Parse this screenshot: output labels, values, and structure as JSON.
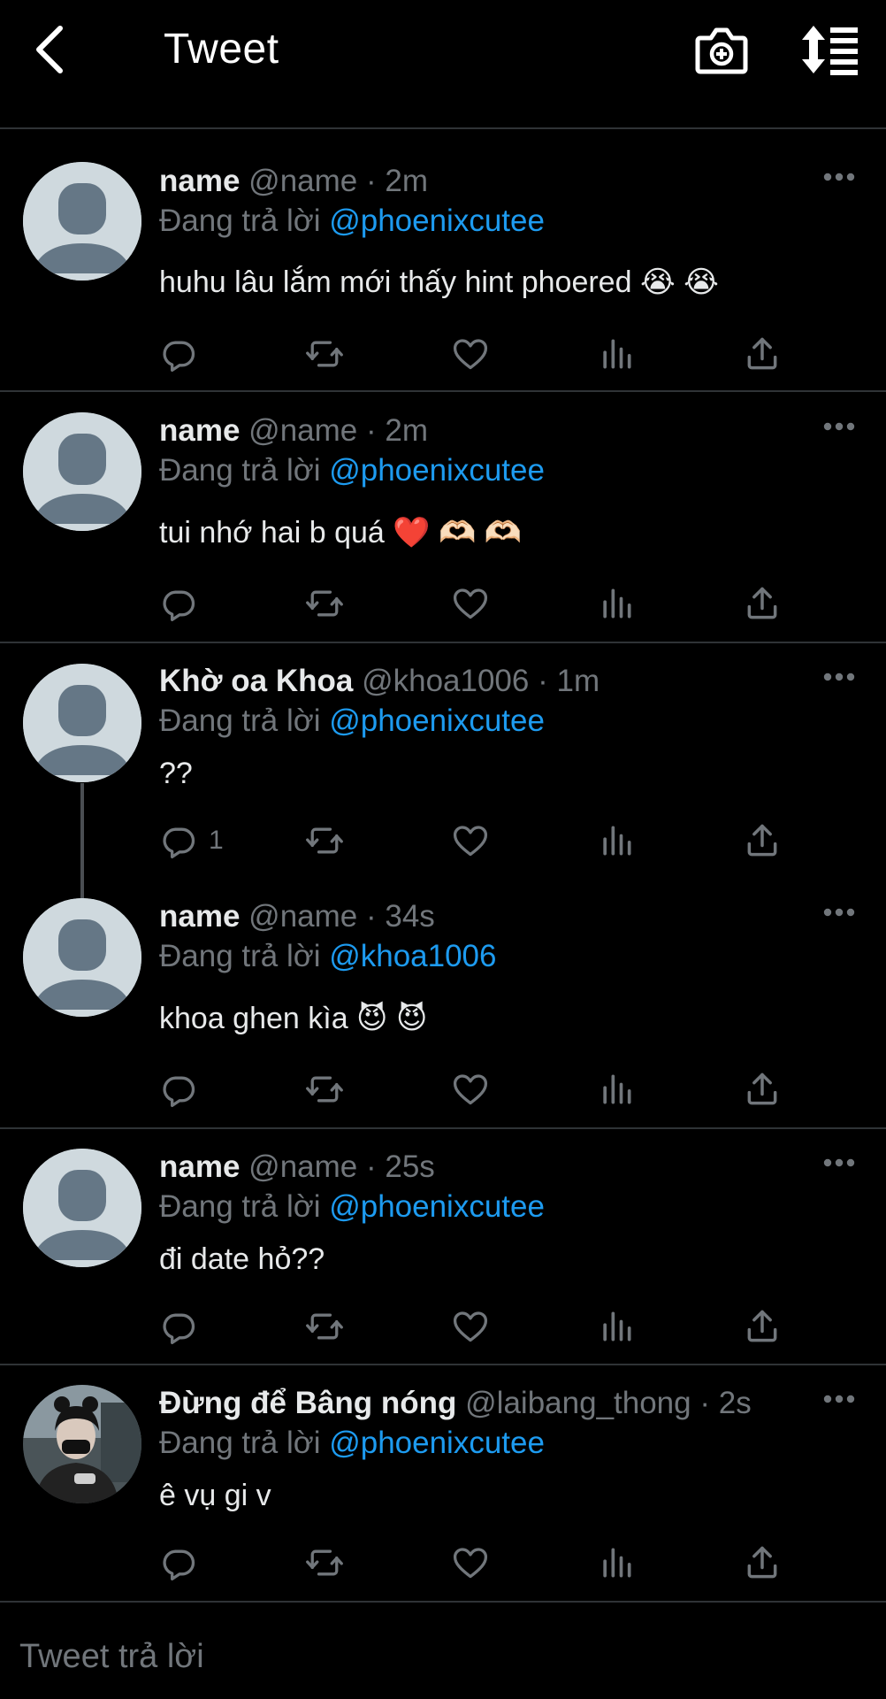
{
  "header": {
    "title": "Tweet",
    "back_icon": "chevron-left-icon",
    "camera_icon": "camera-plus-icon",
    "sort_icon": "sort-icon"
  },
  "tweets": [
    {
      "name": "name",
      "handle": "@name",
      "time": "2m",
      "dot": " · ",
      "replying_label": "Đang trả lời ",
      "replying_to": "@phoenixcutee",
      "text": "huhu lâu lắm mới thấy hint phoered 😭 😭",
      "reply_count": ""
    },
    {
      "name": "name",
      "handle": "@name",
      "time": "2m",
      "dot": " · ",
      "replying_label": "Đang trả lời ",
      "replying_to": "@phoenixcutee",
      "text": "tui nhớ hai b quá ❤️ 🫶🏻 🫶🏻",
      "reply_count": ""
    },
    {
      "name": "Khờ oa Khoa",
      "handle": "@khoa1006",
      "time": "1m",
      "dot": " · ",
      "replying_label": "Đang trả lời ",
      "replying_to": "@phoenixcutee",
      "text": "??",
      "reply_count": "1"
    },
    {
      "name": "name",
      "handle": "@name",
      "time": "34s",
      "dot": " · ",
      "replying_label": "Đang trả lời ",
      "replying_to": "@khoa1006",
      "text": "khoa ghen kìa 😈 😈",
      "reply_count": ""
    },
    {
      "name": "name",
      "handle": "@name",
      "time": "25s",
      "dot": " · ",
      "replying_label": "Đang trả lời ",
      "replying_to": "@phoenixcutee",
      "text": "đi date hỏ??",
      "reply_count": ""
    },
    {
      "name": "Đừng để Bâng nóng",
      "handle": "@laibang_thong",
      "time": "2s",
      "dot": " · ",
      "replying_label": "Đang trả lời ",
      "replying_to": "@phoenixcutee",
      "text": "ê vụ gi v",
      "reply_count": ""
    }
  ],
  "reply_bar": {
    "placeholder": "Tweet trả lời"
  },
  "colors": {
    "background": "#000000",
    "accent": "#1d9bf0",
    "muted": "#71767b",
    "divider": "#2f3336"
  }
}
